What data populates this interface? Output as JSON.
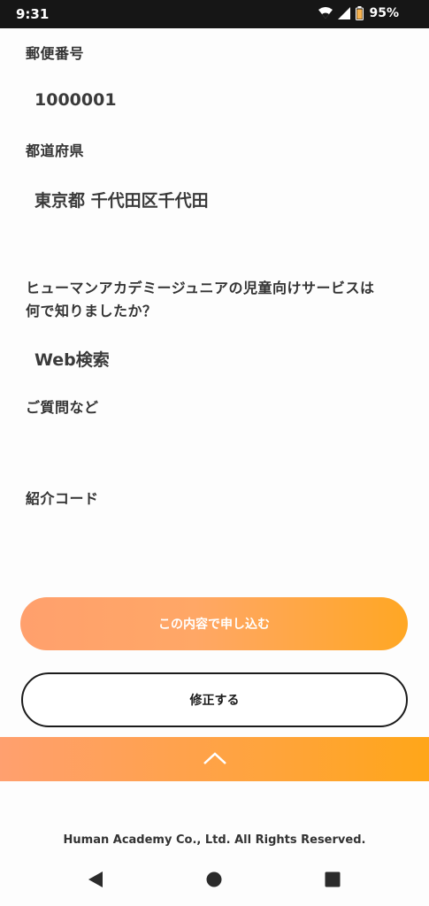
{
  "status_bar": {
    "time": "9:31",
    "battery": "95%",
    "icons": [
      "wifi-icon",
      "signal-icon",
      "battery-icon"
    ]
  },
  "form": {
    "postal_code_label": "郵便番号",
    "postal_code_value": "1000001",
    "prefecture_label": "都道府県",
    "address_value": "東京都 千代田区千代田",
    "source_question_line1": "ヒューマンアカデミージュニアの児童向けサービスは",
    "source_question_line2": "何で知りましたか？",
    "source_answer": "Web検索",
    "questions_label": "ご質問など",
    "referral_label": "紹介コード"
  },
  "actions": {
    "submit_label": "この内容で申し込む",
    "edit_label": "修正する"
  },
  "footer": {
    "copyright": "Human Academy Co., Ltd. All Rights Reserved."
  },
  "colors": {
    "accent_start": "#ffa06d",
    "accent_end": "#ffa724",
    "status_bar": "#161616"
  }
}
